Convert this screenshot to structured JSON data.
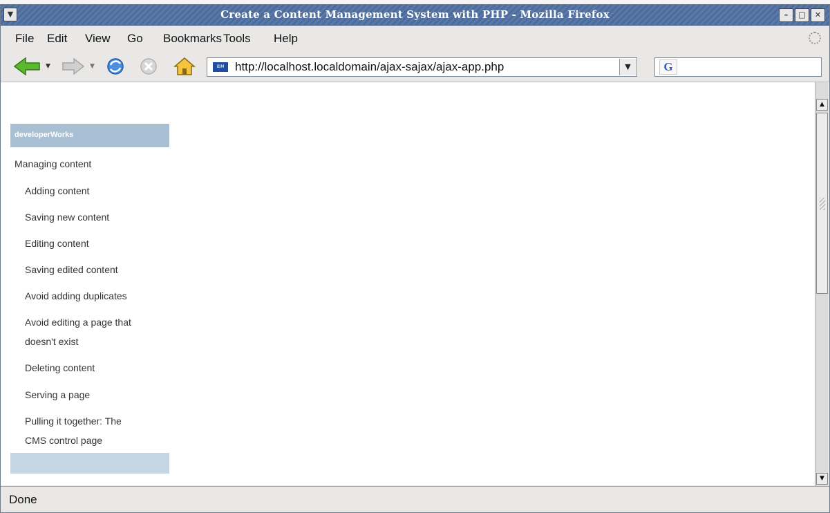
{
  "window": {
    "title": "Create a Content Management System with PHP - Mozilla Firefox"
  },
  "menubar": {
    "items": [
      "File",
      "Edit",
      "View",
      "Go",
      "Bookmarks",
      "Tools",
      "Help"
    ]
  },
  "navbar": {
    "url": "http://localhost.localdomain/ajax-sajax/ajax-app.php",
    "favicon_text": "IBM",
    "search_engine_glyph": "G"
  },
  "sidebar": {
    "header": "developerWorks",
    "items": [
      {
        "label": "Managing content",
        "level": 0
      },
      {
        "label": "Adding content",
        "level": 1
      },
      {
        "label": "Saving new content",
        "level": 1
      },
      {
        "label": "Editing content",
        "level": 1
      },
      {
        "label": "Saving edited content",
        "level": 1
      },
      {
        "label": "Avoid adding duplicates",
        "level": 1
      },
      {
        "label": "Avoid editing a page that",
        "level": 1
      },
      {
        "label": "doesn't exist",
        "level": 1
      },
      {
        "label": "Deleting content",
        "level": 1
      },
      {
        "label": "Serving a page",
        "level": 1
      },
      {
        "label": "Pulling it together: The",
        "level": 1
      },
      {
        "label": "CMS control page",
        "level": 1
      }
    ]
  },
  "statusbar": {
    "text": "Done"
  },
  "colors": {
    "titlebar": "#4d6c9c",
    "sidebar_header": "#a9bfd3",
    "sidebar_footer": "#c6d5e3"
  }
}
